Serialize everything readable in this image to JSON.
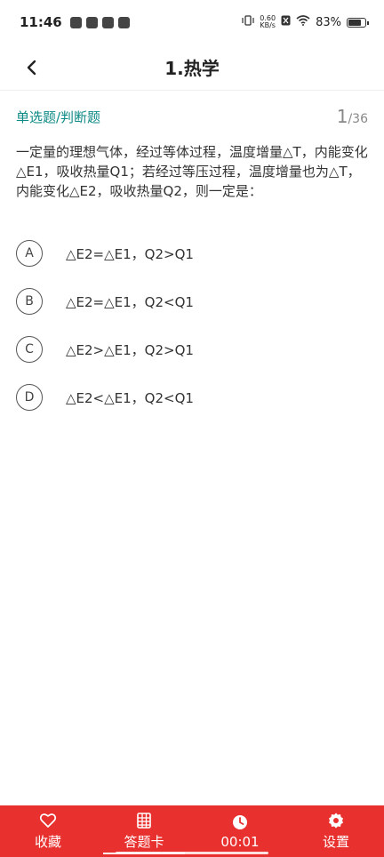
{
  "status_bar": {
    "time": "11:46",
    "net_speed_value": "0.60",
    "net_speed_unit": "KB/s",
    "battery": "83%"
  },
  "header": {
    "title": "1.热学"
  },
  "question": {
    "type": "单选题/判断题",
    "current": "1",
    "total": "/36",
    "text": "一定量的理想气体，经过等体过程，温度增量△T，内能变化△E1，吸收热量Q1；若经过等压过程，温度增量也为△T，内能变化△E2，吸收热量Q2，则一定是：",
    "options": [
      {
        "letter": "A",
        "text": "△E2=△E1，Q2>Q1"
      },
      {
        "letter": "B",
        "text": "△E2=△E1，Q2<Q1"
      },
      {
        "letter": "C",
        "text": "△E2>△E1，Q2>Q1"
      },
      {
        "letter": "D",
        "text": "△E2<△E1，Q2<Q1"
      }
    ]
  },
  "bottom_bar": {
    "favorite_label": "收藏",
    "answer_card_label": "答题卡",
    "timer_label": "00:01",
    "settings_label": "设置"
  },
  "colors": {
    "accent": "#e8312f",
    "qtype": "#0e8a86"
  }
}
